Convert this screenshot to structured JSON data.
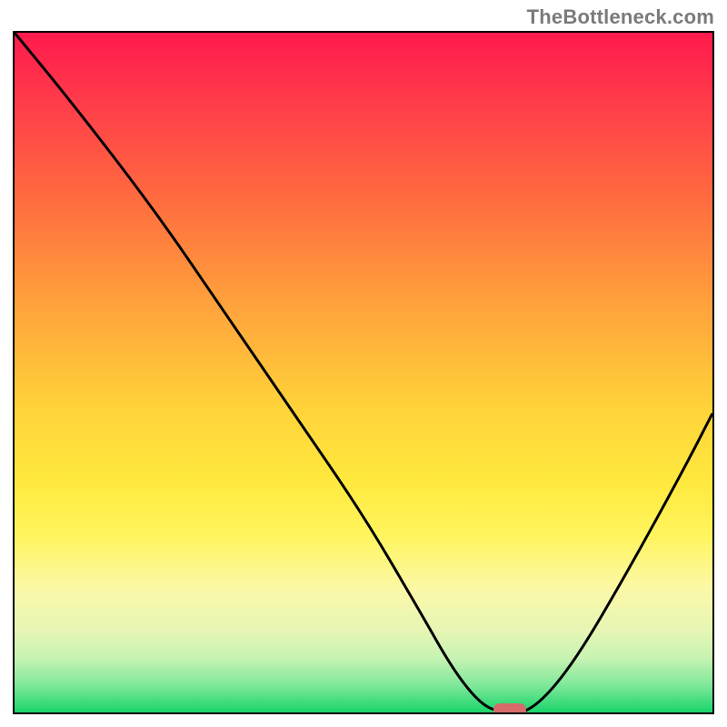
{
  "watermark": "TheBottleneck.com",
  "chart_data": {
    "type": "line",
    "title": "",
    "xlabel": "",
    "ylabel": "",
    "xlim": [
      0,
      100
    ],
    "ylim": [
      0,
      100
    ],
    "series": [
      {
        "name": "curve",
        "x": [
          0,
          8,
          20,
          30,
          40,
          50,
          58,
          63,
          67,
          70,
          74,
          80,
          88,
          96,
          100
        ],
        "values": [
          100,
          90,
          74,
          59,
          44,
          29,
          15,
          6,
          1,
          0,
          0,
          7,
          21,
          36,
          44
        ]
      }
    ],
    "marker": {
      "x": 71,
      "y": 0
    },
    "gradient_stops": [
      {
        "pct": 0,
        "color": "#ff1a4d"
      },
      {
        "pct": 24,
        "color": "#ff6a3f"
      },
      {
        "pct": 55,
        "color": "#ffd23a"
      },
      {
        "pct": 82,
        "color": "#fbf8a8"
      },
      {
        "pct": 100,
        "color": "#19d46a"
      }
    ]
  }
}
